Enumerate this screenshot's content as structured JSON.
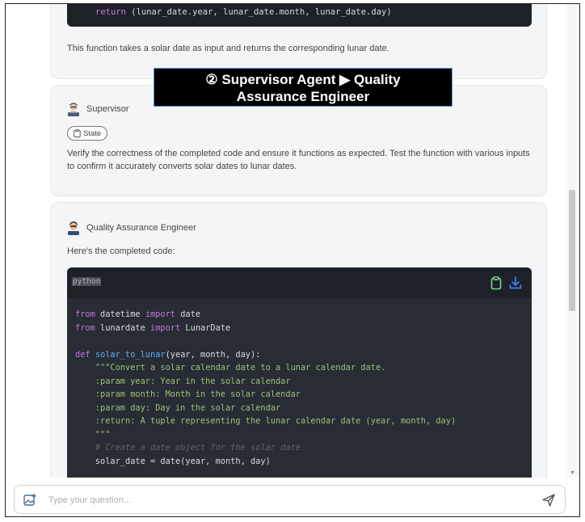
{
  "previous_message": {
    "code_line": {
      "keyword": "return",
      "rest": " (lunar_date.year, lunar_date.month, lunar_date.day)"
    },
    "description": "This function takes a solar date as input and returns the corresponding lunar date."
  },
  "banner": {
    "line1": "② Supervisor Agent ▶ Quality",
    "line2": "Assurance Engineer"
  },
  "supervisor": {
    "name": "Supervisor",
    "avatar_icon": "supervisor-avatar-icon",
    "pill_label": "State",
    "text": "Verify the correctness of the completed code and ensure it functions as expected. Test the function with various inputs to confirm it accurately converts solar dates to lunar dates."
  },
  "qa": {
    "name": "Quality Assurance Engineer",
    "avatar_icon": "qa-engineer-avatar-icon",
    "intro": "Here's the completed code:",
    "code": {
      "language": "python",
      "copy_icon": "clipboard-icon",
      "download_icon": "download-icon",
      "lines": [
        [
          [
            "kw",
            "from"
          ],
          [
            "",
            " datetime "
          ],
          [
            "kw",
            "import"
          ],
          [
            "",
            " date"
          ]
        ],
        [
          [
            "kw",
            "from"
          ],
          [
            "",
            " lunardate "
          ],
          [
            "kw",
            "import"
          ],
          [
            "",
            " LunarDate"
          ]
        ],
        [],
        [
          [
            "kw",
            "def"
          ],
          [
            "",
            " "
          ],
          [
            "fn",
            "solar_to_lunar"
          ],
          [
            "",
            "(year, month, day):"
          ]
        ],
        [
          [
            "",
            "    "
          ],
          [
            "str",
            "\"\"\"Convert a solar calendar date to a lunar calendar date."
          ]
        ],
        [
          [
            "str",
            "    :param year: Year in the solar calendar"
          ]
        ],
        [
          [
            "str",
            "    :param month: Month in the solar calendar"
          ]
        ],
        [
          [
            "str",
            "    :param day: Day in the solar calendar"
          ]
        ],
        [
          [
            "str",
            "    :return: A tuple representing the lunar calendar date (year, month, day)"
          ]
        ],
        [
          [
            "str",
            "    \"\"\""
          ]
        ],
        [
          [
            "",
            "    "
          ],
          [
            "cm",
            "# Create a date object for the solar date"
          ]
        ],
        [
          [
            "",
            "    solar_date = date(year, month, day)"
          ]
        ]
      ]
    }
  },
  "input": {
    "placeholder": "Type your question...",
    "value": ""
  },
  "colors": {
    "keyword": "#c678dd",
    "function": "#61afef",
    "string": "#98c379",
    "comment": "#5c6370",
    "copy_icon": "#7bd88f",
    "download_icon": "#3b82f6",
    "send_icon": "#555555"
  }
}
